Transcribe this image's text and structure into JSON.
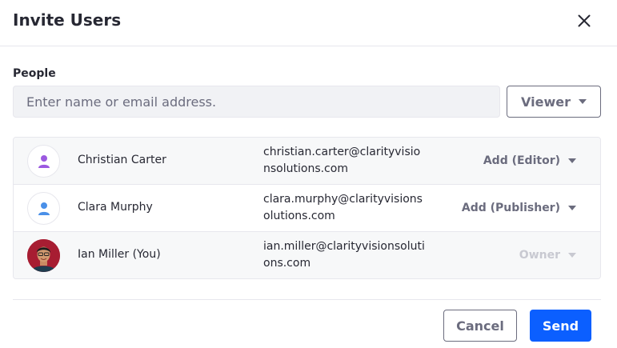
{
  "dialog": {
    "title": "Invite Users"
  },
  "people": {
    "label": "People",
    "search_placeholder": "Enter name or email address.",
    "role_select": "Viewer"
  },
  "members": [
    {
      "name": "Christian Carter",
      "email": "christian.carter@clarityvisionsolutions.com",
      "role": "Add (Editor)",
      "avatar": "user-icon",
      "avatar_color": "#9b59e0"
    },
    {
      "name": "Clara Murphy",
      "email": "clara.murphy@clarityvisionsolutions.com",
      "role": "Add (Publisher)",
      "avatar": "user-icon",
      "avatar_color": "#4a90e8"
    },
    {
      "name": "Ian Miller (You)",
      "email": "ian.miller@clarityvisionsolutions.com",
      "role": "Owner",
      "avatar": "profile-photo"
    }
  ],
  "footer": {
    "cancel_label": "Cancel",
    "send_label": "Send"
  },
  "colors": {
    "primary": "#0b5fff",
    "secondary_text": "#6b6c7e",
    "disabled_text": "#c8c9d1"
  }
}
